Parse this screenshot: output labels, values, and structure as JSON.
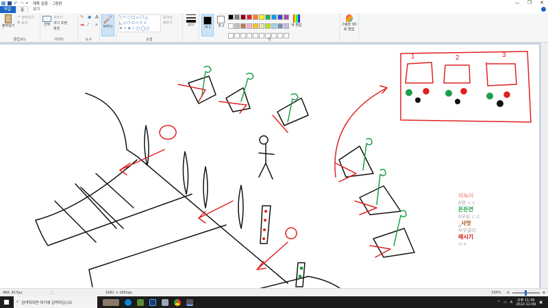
{
  "window": {
    "title": "제목 없음 - 그림판",
    "minimize": "—",
    "maximize": "❐",
    "close": "✕"
  },
  "tabs": [
    {
      "label": "파일"
    },
    {
      "label": "홈"
    },
    {
      "label": "보기"
    }
  ],
  "ribbon": {
    "clipboard": {
      "label": "클립보드",
      "paste": "붙여넣기",
      "cut": "잘라내기",
      "copy": "복사"
    },
    "image": {
      "label": "이미지",
      "select": "선택",
      "crop": "자르기",
      "resize": "크기 조정",
      "rotate": "회전"
    },
    "tools": {
      "label": "도구"
    },
    "brushes": {
      "label": "브러시"
    },
    "shapes": {
      "label": "도형",
      "outline": "윤곽선",
      "fill": "채우기"
    },
    "size": {
      "label": "크기"
    },
    "color1": {
      "label": "색 1"
    },
    "color2": {
      "label": "색 2"
    },
    "colors": {
      "label": "색",
      "edit": "색 편집"
    },
    "paint3d": {
      "label": "그림판 3D로 편집"
    }
  },
  "palette": [
    "#000000",
    "#7f7f7f",
    "#880015",
    "#ed1c24",
    "#ff7f27",
    "#fff200",
    "#22b14c",
    "#00a2e8",
    "#3f48cc",
    "#a349a4",
    "#ffffff",
    "#c3c3c3",
    "#b97a57",
    "#ffaec9",
    "#ffc90e",
    "#efe4b0",
    "#b5e61d",
    "#99d9ea",
    "#7092be",
    "#c8bfe7",
    "#ffffff",
    "#ffffff",
    "#ffffff",
    "#ffffff",
    "#ffffff",
    "#ffffff",
    "#ffffff",
    "#ffffff",
    "#ffffff",
    "#ffffff"
  ],
  "canvas_notes": [
    {
      "text": "리녹이",
      "color": "#f0a0a0",
      "sub": "6명 ㄷㄷ"
    },
    {
      "text": "든든연",
      "color": "#1a9e4a",
      "sub": "6부링 ㄷㄷ"
    },
    {
      "text": "_사맛",
      "color": "#a0521a",
      "sub": "부부겔라"
    },
    {
      "text": "레시기",
      "color": "#d01010",
      "sub": "ㅁㅊ"
    }
  ],
  "canvas_numbers": [
    "1",
    "2",
    "3"
  ],
  "status": {
    "cursor": "490, 617px",
    "selection": "",
    "size": "1681 × 1801px",
    "zoom": "100%"
  },
  "taskbar": {
    "search_placeholder": "검색하려면 여기에 입력하십시오",
    "time": "오후 11:39",
    "date": "2022-12-09",
    "ime": "A"
  }
}
